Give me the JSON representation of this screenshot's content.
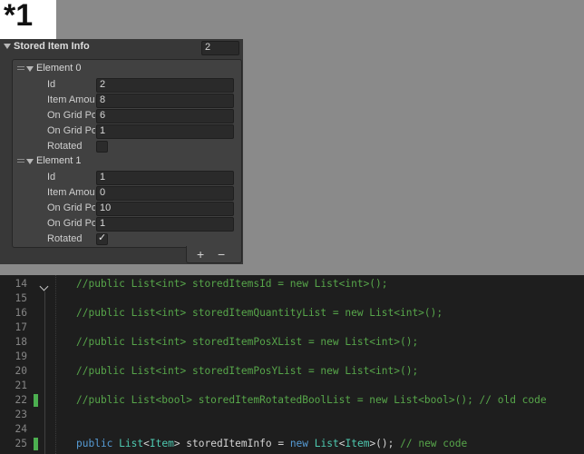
{
  "annotation": {
    "label": "*1"
  },
  "inspector": {
    "title": "Stored Item Info",
    "count": "2",
    "elements": [
      {
        "title": "Element 0",
        "fields": [
          {
            "label": "Id",
            "value": "2"
          },
          {
            "label": "Item Amount",
            "value": "8"
          },
          {
            "label": "On Grid Pos X",
            "value": "6"
          },
          {
            "label": "On Grid Pos Y",
            "value": "1"
          }
        ],
        "rotated_label": "Rotated",
        "rotated_checked": ""
      },
      {
        "title": "Element 1",
        "fields": [
          {
            "label": "Id",
            "value": "1"
          },
          {
            "label": "Item Amount",
            "value": "0"
          },
          {
            "label": "On Grid Pos X",
            "value": "10"
          },
          {
            "label": "On Grid Pos Y",
            "value": "1"
          }
        ],
        "rotated_label": "Rotated",
        "rotated_checked": "✓"
      }
    ],
    "add_label": "+",
    "remove_label": "−"
  },
  "editor": {
    "colors": {
      "comment": "#57a64a",
      "keyword": "#569cd6",
      "type": "#4ec9b0",
      "change_marker": "#4caf50"
    },
    "lines": [
      {
        "number": "14",
        "text": "//public List<int> storedItemsId = new List<int>();"
      },
      {
        "number": "15",
        "text": ""
      },
      {
        "number": "16",
        "text": "//public List<int> storedItemQuantityList = new List<int>();"
      },
      {
        "number": "17",
        "text": ""
      },
      {
        "number": "18",
        "text": "//public List<int> storedItemPosXList = new List<int>();"
      },
      {
        "number": "19",
        "text": ""
      },
      {
        "number": "20",
        "text": "//public List<int> storedItemPosYList = new List<int>();"
      },
      {
        "number": "21",
        "text": ""
      },
      {
        "number": "22",
        "text": "//public List<bool> storedItemRotatedBoolList = new List<bool>(); // old code"
      },
      {
        "number": "23",
        "text": ""
      },
      {
        "number": "24",
        "text": ""
      },
      {
        "number": "25",
        "tokens": {
          "kw_public": "public",
          "sp1": " ",
          "ty_list1": "List",
          "p1": "<",
          "ty_item1": "Item",
          "p2": "> storedItemInfo = ",
          "kw_new": "new",
          "sp2": " ",
          "ty_list2": "List",
          "p3": "<",
          "ty_item2": "Item",
          "p4": ">(); ",
          "cm": "// new code"
        }
      }
    ]
  }
}
